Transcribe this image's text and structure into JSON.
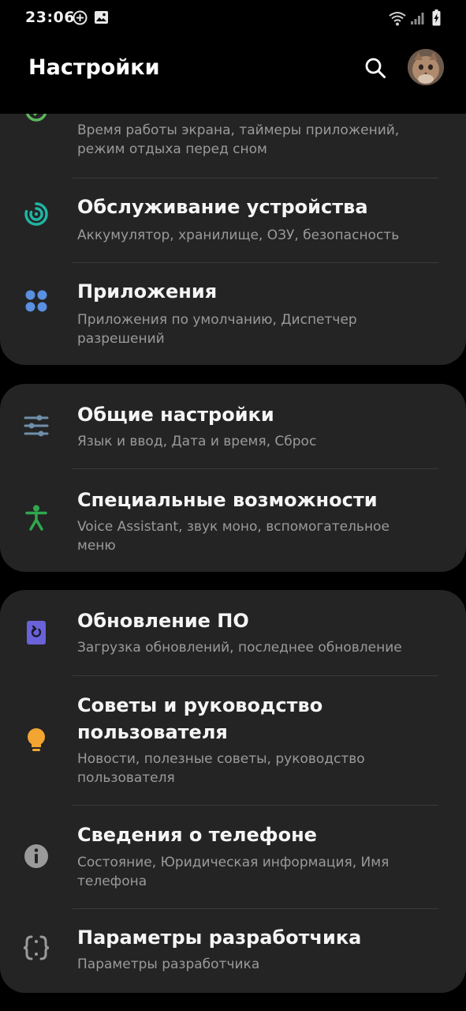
{
  "status_bar": {
    "time": "23:06"
  },
  "header": {
    "title": "Настройки"
  },
  "cards": [
    {
      "rows": [
        {
          "title": "",
          "subtitle": "Время работы экрана, таймеры приложений, режим отдыха перед сном",
          "icon": "digital-wellbeing-icon",
          "color": "#5cb85c"
        },
        {
          "title": "Обслуживание устройства",
          "subtitle": "Аккумулятор, хранилище, ОЗУ, безопасность",
          "icon": "device-care-icon",
          "color": "#1fb5a4"
        },
        {
          "title": "Приложения",
          "subtitle": "Приложения по умолчанию, Диспетчер разрешений",
          "icon": "apps-icon",
          "color": "#5b8fe0"
        }
      ]
    },
    {
      "rows": [
        {
          "title": "Общие настройки",
          "subtitle": "Язык и ввод, Дата и время, Сброс",
          "icon": "general-management-icon",
          "color": "#6f8faa"
        },
        {
          "title": "Специальные возможности",
          "subtitle": "Voice Assistant, звук моно, вспомогательное меню",
          "icon": "accessibility-icon",
          "color": "#2fa84f"
        }
      ]
    },
    {
      "rows": [
        {
          "title": "Обновление ПО",
          "subtitle": "Загрузка обновлений, последнее обновление",
          "icon": "software-update-icon",
          "color": "#6a62d8"
        },
        {
          "title": "Советы и руководство пользователя",
          "subtitle": "Новости, полезные советы, руководство пользователя",
          "icon": "tips-lightbulb-icon",
          "color": "#f2a530"
        },
        {
          "title": "Сведения о телефоне",
          "subtitle": "Состояние, Юридическая информация, Имя телефона",
          "icon": "info-icon",
          "color": "#9a9a9a"
        },
        {
          "title": "Параметры разработчика",
          "subtitle": "Параметры разработчика",
          "icon": "developer-braces-icon",
          "color": "#9a9a9a"
        }
      ]
    }
  ]
}
